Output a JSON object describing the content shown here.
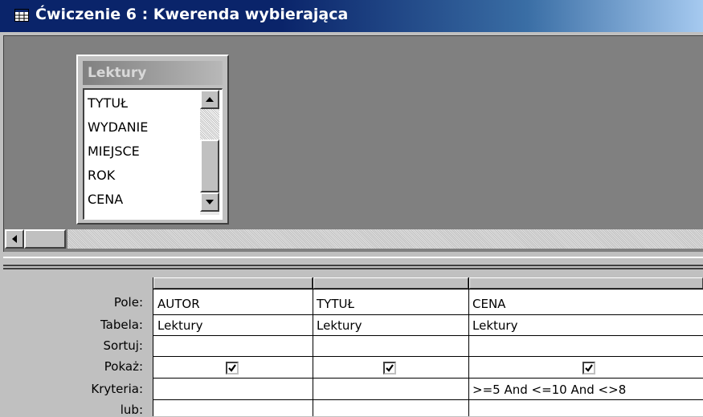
{
  "window": {
    "title": "Ćwiczenie 6 : Kwerenda wybierająca",
    "icon": "query-icon"
  },
  "table_box": {
    "title": "Lektury",
    "fields": [
      "TYTUŁ",
      "WYDANIE",
      "MIEJSCE",
      "ROK",
      "CENA"
    ]
  },
  "grid": {
    "row_labels": {
      "pole": "Pole:",
      "tabela": "Tabela:",
      "sortuj": "Sortuj:",
      "pokaz": "Pokaż:",
      "kryteria": "Kryteria:",
      "lub": "lub:"
    },
    "columns": [
      {
        "pole": "AUTOR",
        "tabela": "Lektury",
        "sortuj": "",
        "pokaz": true,
        "kryteria": ""
      },
      {
        "pole": "TYTUŁ",
        "tabela": "Lektury",
        "sortuj": "",
        "pokaz": true,
        "kryteria": ""
      },
      {
        "pole": "CENA",
        "tabela": "Lektury",
        "sortuj": "",
        "pokaz": true,
        "kryteria": ">=5 And <=10 And <>8"
      }
    ]
  }
}
